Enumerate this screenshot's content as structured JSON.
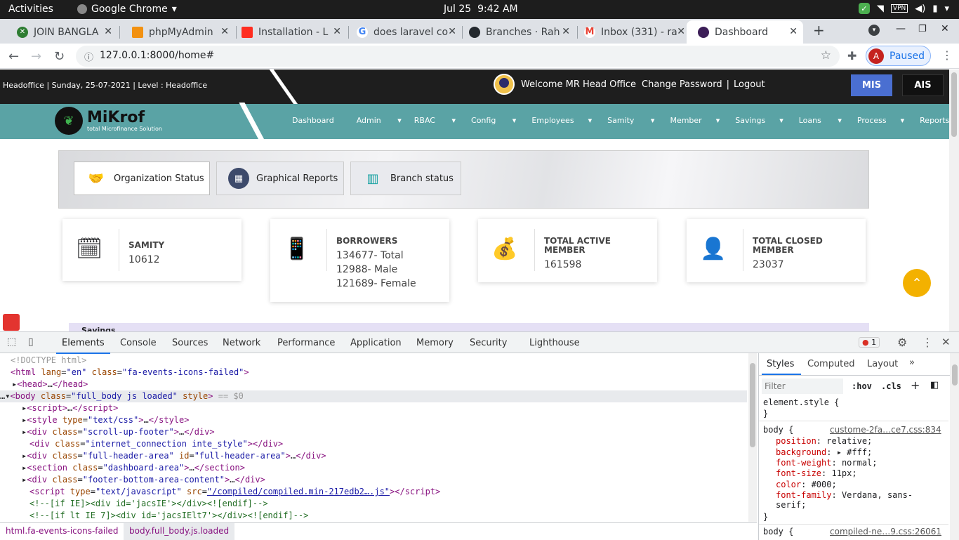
{
  "gnome": {
    "activities": "Activities",
    "app": "Google Chrome",
    "date": "Jul 25",
    "time": "9:42 AM"
  },
  "tabs": [
    {
      "label": "JOIN BANGLA",
      "color": "#2e7d32"
    },
    {
      "label": "phpMyAdmin",
      "color": "#f29111"
    },
    {
      "label": "Installation - L",
      "color": "#ff2d20"
    },
    {
      "label": "does laravel co",
      "color": "#4285f4"
    },
    {
      "label": "Branches · Rah",
      "color": "#24292e"
    },
    {
      "label": "Inbox (331) - ra",
      "color": "#ea4335"
    },
    {
      "label": "Dashboard",
      "color": "#3c1e57"
    }
  ],
  "toolbar": {
    "url": "127.0.0.1:8000/home#",
    "profile_initial": "A",
    "profile_status": "Paused"
  },
  "header": {
    "info": "Headoffice |  Sunday, 25-07-2021 | Level : Headoffice",
    "welcome": "Welcome MR Head Office",
    "change_password": "Change Password",
    "separator": "|",
    "logout": "Logout",
    "mis": "MIS",
    "ais": "AIS"
  },
  "logo": {
    "name": "MiKrof",
    "tagline": "total Microfinance Solution"
  },
  "menu": [
    "Dashboard",
    "Admin",
    "RBAC",
    "Config",
    "Employees",
    "Samity",
    "Member",
    "Savings",
    "Loans",
    "Process",
    "Reports"
  ],
  "dash_tabs": [
    "Organization Status",
    "Graphical Reports",
    "Branch status"
  ],
  "cards": [
    {
      "title": "SAMITY",
      "values": [
        "10612"
      ]
    },
    {
      "title": "BORROWERS",
      "values": [
        "134677- Total",
        "12988- Male",
        "121689- Female"
      ]
    },
    {
      "title": "TOTAL ACTIVE MEMBER",
      "values": [
        "161598"
      ]
    },
    {
      "title": "TOTAL CLOSED MEMBER",
      "values": [
        "23037"
      ]
    }
  ],
  "savings_label": "Savings",
  "devtools": {
    "tabs": [
      "Elements",
      "Console",
      "Sources",
      "Network",
      "Performance",
      "Application",
      "Memory",
      "Security",
      "Lighthouse"
    ],
    "error_count": "1",
    "side_tabs": [
      "Styles",
      "Computed",
      "Layout"
    ],
    "filter_placeholder": "Filter",
    "hov": ":hov",
    "cls": ".cls",
    "breadcrumbs": [
      "html.fa-events-icons-failed",
      "body.full_body.js.loaded"
    ],
    "element_style": "element.style {",
    "close_brace": "}",
    "rule1_selector": "body {",
    "rule1_source": "custome-2fa…ce7.css:834",
    "rule1_props": [
      {
        "name": "position",
        "value": "relative;"
      },
      {
        "name": "background",
        "value": "▸ #fff;"
      },
      {
        "name": "font-weight",
        "value": "normal;"
      },
      {
        "name": "font-size",
        "value": "11px;"
      },
      {
        "name": "color",
        "value": "#000;"
      },
      {
        "name": "font-family",
        "value": "Verdana, sans-serif;"
      }
    ],
    "rule2_selector": "body {",
    "rule2_source": "compiled-ne…9.css:26061"
  }
}
